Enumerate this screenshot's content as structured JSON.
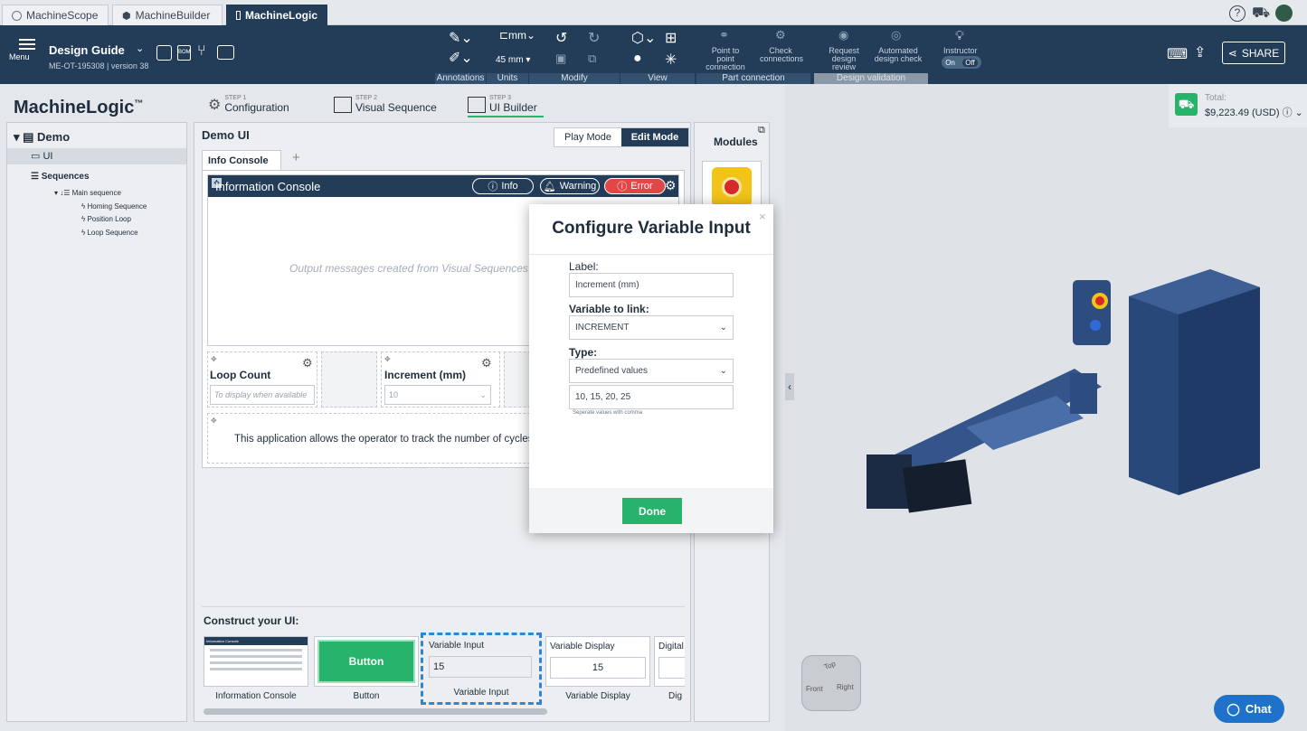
{
  "tabs": [
    {
      "label": "MachineScope"
    },
    {
      "label": "MachineBuilder"
    },
    {
      "label": "MachineLogic"
    }
  ],
  "toolbar": {
    "menu_label": "Menu",
    "doc_title": "Design Guide",
    "doc_subtitle": "ME-OT-195308 | version 38",
    "units_value": "45 mm",
    "group_labels": [
      "Annotations",
      "Units",
      "Modify",
      "View",
      "Part connection",
      "Design validation"
    ],
    "point_to_point": "Point to point connection",
    "check_connections": "Check connections",
    "request_review": "Request design review",
    "automated_check": "Automated design check",
    "instructor": "Instructor",
    "instructor_on": "On",
    "instructor_off": "Off",
    "share": "SHARE"
  },
  "logic": {
    "brand": "MachineLogic",
    "tm": "™",
    "steps": [
      {
        "step": "STEP 1",
        "label": "Configuration"
      },
      {
        "step": "STEP 2",
        "label": "Visual Sequence"
      },
      {
        "step": "STEP 3",
        "label": "UI Builder"
      }
    ]
  },
  "tree": {
    "root": "Demo",
    "ui": "UI",
    "sequences": "Sequences",
    "main": "Main sequence",
    "children": [
      "Homing Sequence",
      "Position Loop",
      "Loop Sequence"
    ]
  },
  "builder": {
    "title": "Demo UI",
    "play_mode": "Play Mode",
    "edit_mode": "Edit Mode",
    "modules": "Modules",
    "console_tab": "Info Console",
    "add_tab": "+",
    "console_title": "Information Console",
    "btn_info": "Info",
    "btn_warning": "Warning",
    "btn_error": "Error",
    "console_placeholder": "Output messages created from Visual Sequences will",
    "loop_count_label": "Loop Count",
    "loop_count_placeholder": "To display when available",
    "increment_label": "Increment (mm)",
    "increment_value": "10",
    "description": "This application allows the operator to track the number of cycles and se",
    "construct_title": "Construct your UI:",
    "palette": [
      {
        "label": "Information Console",
        "preview": "Information Console"
      },
      {
        "label": "Button",
        "preview": "Button"
      },
      {
        "label": "Variable Input",
        "preview": "Variable Input",
        "value": "15"
      },
      {
        "label": "Variable Display",
        "preview": "Variable Display",
        "value": "15"
      },
      {
        "label": "Dig",
        "preview": "Digital I"
      }
    ]
  },
  "modal": {
    "title": "Configure Variable Input",
    "close": "×",
    "label_label": "Label:",
    "label_value": "Increment (mm)",
    "variable_label": "Variable to link:",
    "variable_value": "INCREMENT",
    "type_label": "Type:",
    "type_value": "Predefined values",
    "values": "10, 15, 20, 25",
    "hint": "Seperate values with comma",
    "done": "Done"
  },
  "cart": {
    "total_label": "Total:",
    "total_value": "$9,223.49 (USD)"
  },
  "viewer": {
    "cube_top": "Top",
    "cube_front": "Front",
    "cube_right": "Right",
    "chat": "Chat",
    "collapse": "‹"
  },
  "colors": {
    "navy": "#233c58",
    "green": "#27b46a",
    "error": "#e04848",
    "chat": "#1f72c9"
  }
}
